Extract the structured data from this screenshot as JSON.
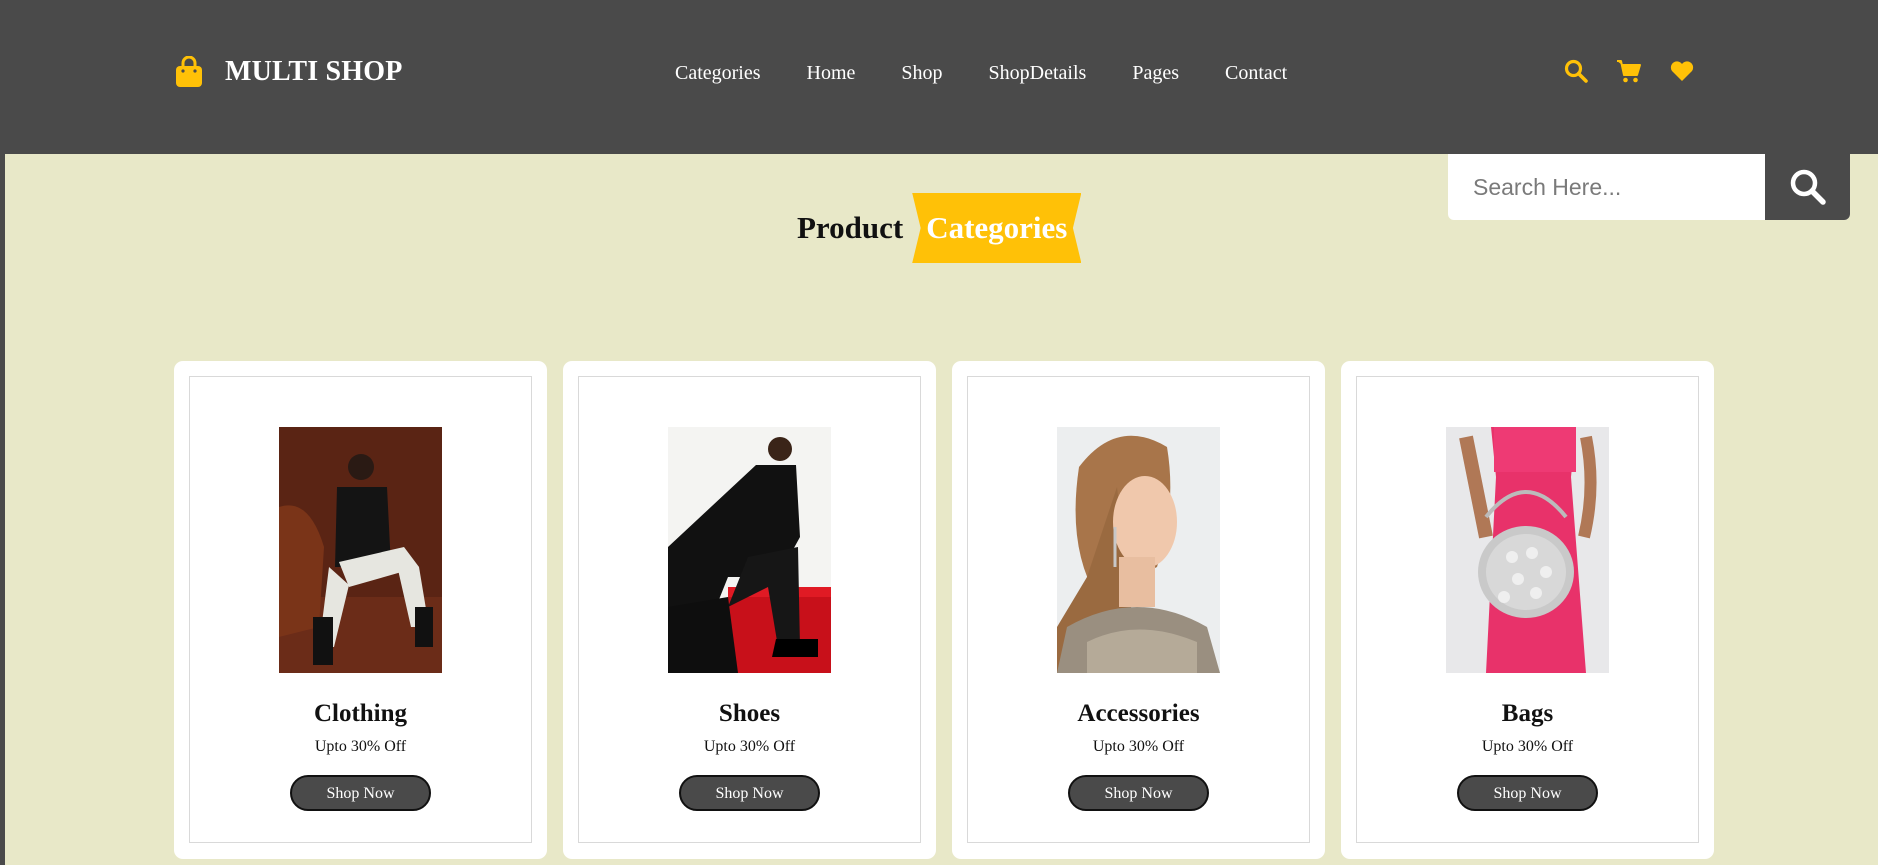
{
  "brand": {
    "name": "MULTI SHOP",
    "icon": "shopping-bag-icon",
    "accent": "#ffc107",
    "header_bg": "#4a4a4a",
    "page_bg": "#e8e8c8"
  },
  "nav": [
    {
      "label": "Categories"
    },
    {
      "label": "Home"
    },
    {
      "label": "Shop"
    },
    {
      "label": "ShopDetails"
    },
    {
      "label": "Pages"
    },
    {
      "label": "Contact"
    }
  ],
  "header_icons": [
    "search-icon",
    "cart-icon",
    "heart-icon"
  ],
  "search": {
    "placeholder": "Search Here...",
    "button_icon": "search-icon"
  },
  "section": {
    "title_plain": "Product",
    "title_accent": "Categories"
  },
  "cards": [
    {
      "title": "Clothing",
      "subtitle": "Upto 30% Off",
      "button": "Shop Now",
      "image": "woman-in-black-blazer-seated-on-leather-chair"
    },
    {
      "title": "Shoes",
      "subtitle": "Upto 30% Off",
      "button": "Shop Now",
      "image": "woman-in-black-coat-with-platform-loafers-on-red-chair"
    },
    {
      "title": "Accessories",
      "subtitle": "Upto 30% Off",
      "button": "Shop Now",
      "image": "woman-wearing-drop-earrings"
    },
    {
      "title": "Bags",
      "subtitle": "Upto 30% Off",
      "button": "Shop Now",
      "image": "pearl-beaded-handbag-with-pink-dress"
    }
  ]
}
